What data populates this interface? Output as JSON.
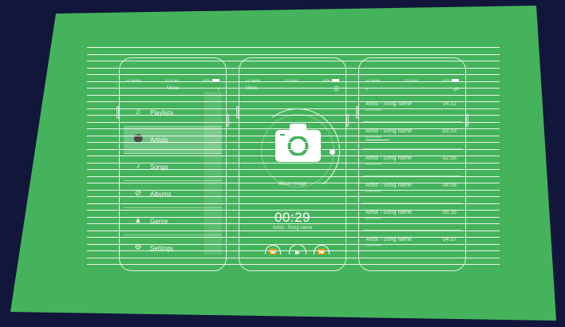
{
  "colors": {
    "background": "#11163a",
    "card": "#45b35c",
    "line": "#ffffff"
  },
  "status_bar": {
    "carrier": "•••• Mobile",
    "time": "12:00 AM",
    "battery": "100%"
  },
  "phone_menu": {
    "title": "Menu",
    "header_icon": "chevron-right-icon",
    "items": [
      {
        "label": "Playlists",
        "icon": "playlist-icon"
      },
      {
        "label": "Artists",
        "icon": "microphone-icon"
      },
      {
        "label": "Songs",
        "icon": "music-note-icon"
      },
      {
        "label": "Albums",
        "icon": "disc-icon"
      },
      {
        "label": "Genre",
        "icon": "guitar-icon"
      },
      {
        "label": "Settings",
        "icon": "gear-icon"
      }
    ],
    "active_index": 1
  },
  "phone_player": {
    "menu_label": "Menu",
    "header_icon": "hamburger-icon",
    "album_label": "Album image",
    "time": "00:29",
    "song": "Artist - Song name",
    "controls": [
      "rewind-icon",
      "play-icon",
      "fast-forward-icon"
    ]
  },
  "phone_list": {
    "header_left_icon": "chevron-left-icon",
    "header_right_icon": "shuffle-icon",
    "tracks": [
      {
        "title": "Artist - Song name",
        "duration": "04:12",
        "sub": "Album name"
      },
      {
        "title": "Artist - Song name",
        "duration": "03:23",
        "sub": "Album name"
      },
      {
        "title": "Artist - Song name",
        "duration": "02:56",
        "sub": "Album name"
      },
      {
        "title": "Artist - Song name",
        "duration": "04:58",
        "sub": "Album name"
      },
      {
        "title": "Artist - Song name",
        "duration": "05:16",
        "sub": "Album name"
      },
      {
        "title": "Artist - Song name",
        "duration": "04:37",
        "sub": "Album name"
      }
    ]
  }
}
